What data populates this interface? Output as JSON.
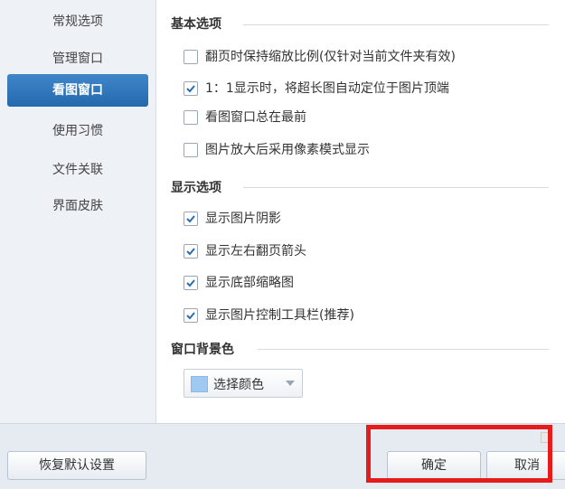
{
  "sidebar": {
    "items": [
      {
        "label": "常规选项",
        "active": false
      },
      {
        "label": "管理窗口",
        "active": false
      },
      {
        "label": "看图窗口",
        "active": true
      },
      {
        "label": "使用习惯",
        "active": false
      },
      {
        "label": "文件关联",
        "active": false
      },
      {
        "label": "界面皮肤",
        "active": false
      }
    ]
  },
  "sections": {
    "basic": {
      "title": "基本选项",
      "options": [
        {
          "label": "翻页时保持缩放比例(仅针对当前文件夹有效)",
          "checked": false
        },
        {
          "label": "1：1显示时，将超长图自动定位于图片顶端",
          "checked": true
        },
        {
          "label": "看图窗口总在最前",
          "checked": false
        },
        {
          "label": "图片放大后采用像素模式显示",
          "checked": false
        }
      ]
    },
    "display": {
      "title": "显示选项",
      "options": [
        {
          "label": "显示图片阴影",
          "checked": true
        },
        {
          "label": "显示左右翻页箭头",
          "checked": true
        },
        {
          "label": "显示底部缩略图",
          "checked": true
        },
        {
          "label": "显示图片控制工具栏(推荐)",
          "checked": true
        }
      ]
    },
    "bgcolor": {
      "title": "窗口背景色",
      "button_label": "选择颜色",
      "swatch_color": "#9ec9f2"
    }
  },
  "footer": {
    "restore_label": "恢复默认设置",
    "ok_label": "确定",
    "cancel_label": "取消"
  },
  "colors": {
    "accent": "#2f78bd",
    "highlight": "#e51c1c",
    "checkmark": "#2a6db3"
  }
}
